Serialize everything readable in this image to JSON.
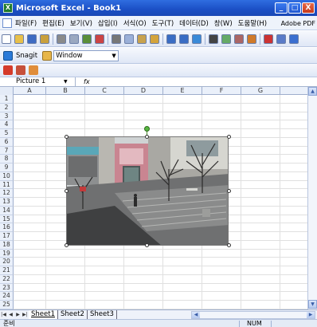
{
  "window": {
    "title": "Microsoft Excel - Book1",
    "app_icon": "X",
    "buttons": [
      "_",
      "□",
      "X"
    ]
  },
  "menu": {
    "items": [
      "파일(F)",
      "편집(E)",
      "보기(V)",
      "삽입(I)",
      "서식(O)",
      "도구(T)",
      "데이터(D)",
      "창(W)",
      "도움말(H)"
    ],
    "right_text": "Adobe PDF",
    "doc_controls": "- ₫ ×"
  },
  "snagit": {
    "label": "Snagit",
    "dropdown_value": "Window"
  },
  "formula_bar": {
    "name_box": "Picture 1",
    "fx_label": "fx",
    "content": ""
  },
  "columns": [
    "A",
    "B",
    "C",
    "D",
    "E",
    "F",
    "G"
  ],
  "rows": [
    "1",
    "2",
    "3",
    "4",
    "5",
    "6",
    "7",
    "8",
    "9",
    "10",
    "11",
    "12",
    "13",
    "14",
    "15",
    "16",
    "17",
    "18",
    "19",
    "20",
    "21",
    "22",
    "23",
    "24",
    "25"
  ],
  "picture": {
    "name": "Picture 1",
    "description_icon": "photo-of-building-courtyard"
  },
  "sheets": {
    "tabs": [
      "Sheet1",
      "Sheet2",
      "Sheet3"
    ],
    "active": "Sheet1"
  },
  "status": {
    "ready": "준비",
    "num": "NUM"
  },
  "colors": {
    "titlebar": "#1b4fc5",
    "toolbar": "#dfe7f6",
    "header": "#eaf0fa",
    "selection_handle": "#57b541"
  }
}
